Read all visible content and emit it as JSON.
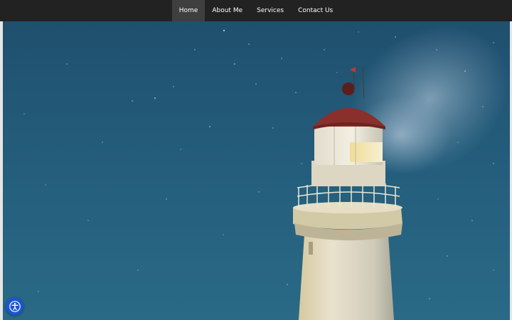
{
  "nav": {
    "items": [
      {
        "label": "Home",
        "active": true
      },
      {
        "label": "About Me",
        "active": false
      },
      {
        "label": "Services",
        "active": false
      },
      {
        "label": "Contact Us",
        "active": false
      }
    ]
  },
  "hero": {
    "image": "night-sky-lighthouse"
  },
  "accessibility": {
    "icon": "accessibility-icon",
    "color": "#1a55d6"
  },
  "colors": {
    "navbar": "#222222",
    "nav_active": "#3f3f3f",
    "sky": "#1f5775"
  }
}
